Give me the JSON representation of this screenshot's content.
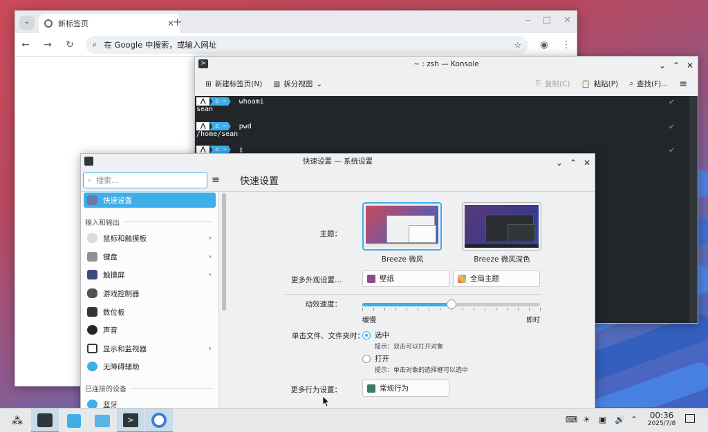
{
  "chrome": {
    "tab_title": "新标签页",
    "omnibox_placeholder": "在 Google 中搜索，或输入网址"
  },
  "konsole": {
    "title": "~ : zsh — Konsole",
    "toolbar": {
      "new_tab": "新建标签页(N)",
      "split_view": "拆分视图",
      "copy": "复制(C)",
      "paste": "粘贴(P)",
      "find": "查找(F)..."
    },
    "prompt_path": "~",
    "lines": [
      {
        "cmd": "whoami",
        "out": "sean"
      },
      {
        "cmd": "pwd",
        "out": "/home/sean"
      },
      {
        "cmd": "",
        "out": ""
      }
    ]
  },
  "settings": {
    "title": "快速设置 — 系统设置",
    "search_placeholder": "搜索...",
    "page_title": "快速设置",
    "sidebar": {
      "selected": "快速设置",
      "group_io": "输入和输出",
      "items": [
        {
          "label": "鼠标和触摸板",
          "arrow": true
        },
        {
          "label": "键盘",
          "arrow": true
        },
        {
          "label": "触摸屏",
          "arrow": true
        },
        {
          "label": "游戏控制器",
          "arrow": false
        },
        {
          "label": "数位板",
          "arrow": false
        },
        {
          "label": "声音",
          "arrow": false
        },
        {
          "label": "显示和监视器",
          "arrow": true
        },
        {
          "label": "无障碍辅助",
          "arrow": false
        }
      ],
      "group_devices": "已连接的设备",
      "bluetooth": "蓝牙"
    },
    "theme_label": "主题：",
    "theme_light": "Breeze 微风",
    "theme_dark": "Breeze 微风深色",
    "more_appearance_label": "更多外观设置...",
    "wallpaper_btn": "壁纸",
    "global_theme_btn": "全局主题",
    "animation_label": "动效速度：",
    "animation_slow": "缓慢",
    "animation_instant": "即时",
    "animation_speed_fraction": 0.5,
    "click_label": "单击文件、文件夹时：",
    "click_select": "选中",
    "click_select_hint": "提示：双击可以打开对象",
    "click_open": "打开",
    "click_open_hint": "提示：单击对象的选择框可以选中",
    "more_behavior_label": "更多行为设置：",
    "general_behavior_btn": "常规行为"
  },
  "taskbar": {
    "time": "00:36",
    "date": "2025/7/8"
  }
}
